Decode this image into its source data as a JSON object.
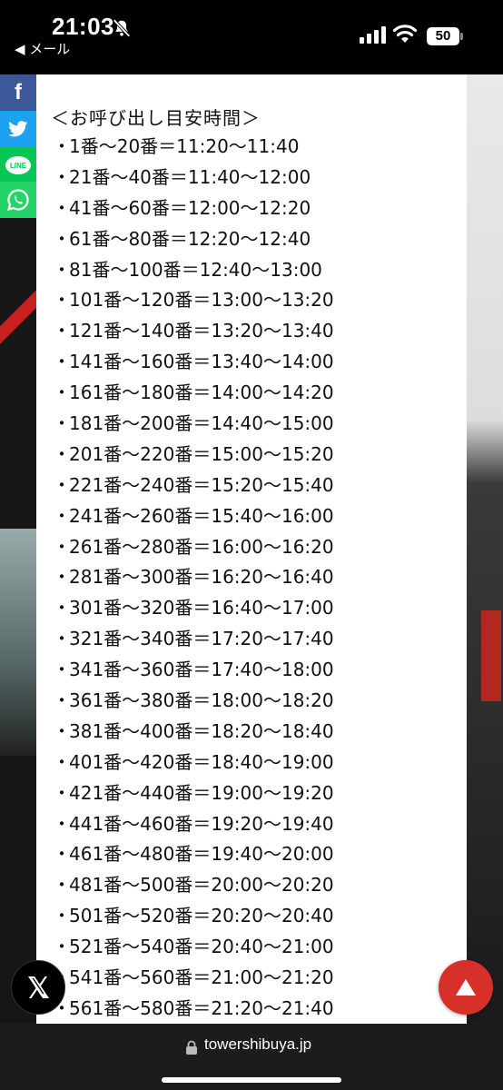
{
  "status_bar": {
    "time": "21:03",
    "back_label": "◀ メール",
    "battery": "50"
  },
  "share": {
    "facebook_glyph": "f",
    "line_label": "LINE"
  },
  "content": {
    "heading": "＜お呼び出し目安時間＞",
    "bullet": "・",
    "items": [
      "1番～20番＝11:20～11:40",
      "21番～40番＝11:40～12:00",
      "41番～60番＝12:00～12:20",
      "61番～80番＝12:20～12:40",
      "81番～100番＝12:40～13:00",
      "101番～120番＝13:00～13:20",
      "121番～140番＝13:20～13:40",
      "141番～160番＝13:40～14:00",
      "161番～180番＝14:00～14:20",
      "181番～200番＝14:40～15:00",
      "201番～220番＝15:00～15:20",
      "221番～240番＝15:20～15:40",
      "241番～260番＝15:40～16:00",
      "261番～280番＝16:00～16:20",
      "281番～300番＝16:20～16:40",
      "301番～320番＝16:40～17:00",
      "321番～340番＝17:20～17:40",
      "341番～360番＝17:40～18:00",
      "361番～380番＝18:00～18:20",
      "381番～400番＝18:20～18:40",
      "401番～420番＝18:40～19:00",
      "421番～440番＝19:00～19:20",
      "441番～460番＝19:20～19:40",
      "461番～480番＝19:40～20:00",
      "481番～500番＝20:00～20:20",
      "501番～520番＝20:20～20:40",
      "521番～540番＝20:40～21:00",
      "541番～560番＝21:00～21:20",
      "561番～580番＝21:20～21:40"
    ]
  },
  "url_bar": {
    "url": "towershibuya.jp"
  },
  "colors": {
    "facebook": "#3b5998",
    "twitter": "#1da1f2",
    "line": "#06c755",
    "whatsapp": "#25d366",
    "page_top_button": "#d7302a"
  },
  "icons": {
    "silent": "bell-slash-icon",
    "signal": "cellular-signal-icon",
    "wifi": "wifi-icon",
    "battery": "battery-icon",
    "facebook": "facebook-icon",
    "twitter": "twitter-bird-icon",
    "line": "line-icon",
    "whatsapp": "whatsapp-icon",
    "x": "x-logo-icon",
    "page_top": "triangle-up-icon",
    "lock": "lock-icon"
  }
}
